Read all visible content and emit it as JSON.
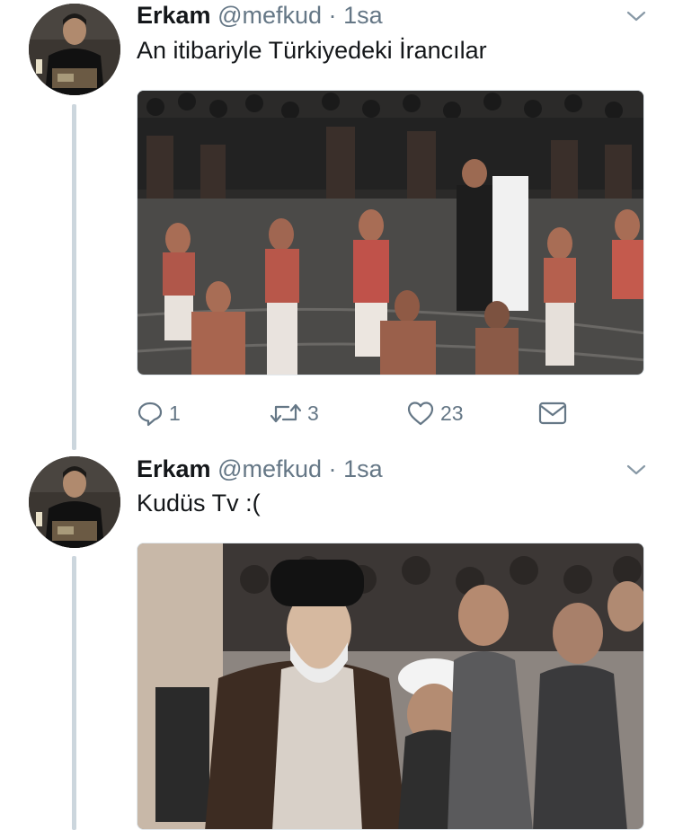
{
  "tweets": [
    {
      "name": "Erkam",
      "handle": "@mefkud",
      "separator": "·",
      "time": "1sa",
      "text": "An itibariyle Türkiyedeki İrancılar",
      "actions": {
        "reply_count": "1",
        "retweet_count": "3",
        "like_count": "23"
      }
    },
    {
      "name": "Erkam",
      "handle": "@mefkud",
      "separator": "·",
      "time": "1sa",
      "text": "Kudüs Tv :("
    }
  ],
  "icons": {
    "reply": "reply-icon",
    "retweet": "retweet-icon",
    "like": "heart-icon",
    "dm": "envelope-icon",
    "menu": "chevron-down-icon"
  },
  "colors": {
    "text": "#14171a",
    "muted": "#657786",
    "thread_line": "#ccd6dd"
  }
}
